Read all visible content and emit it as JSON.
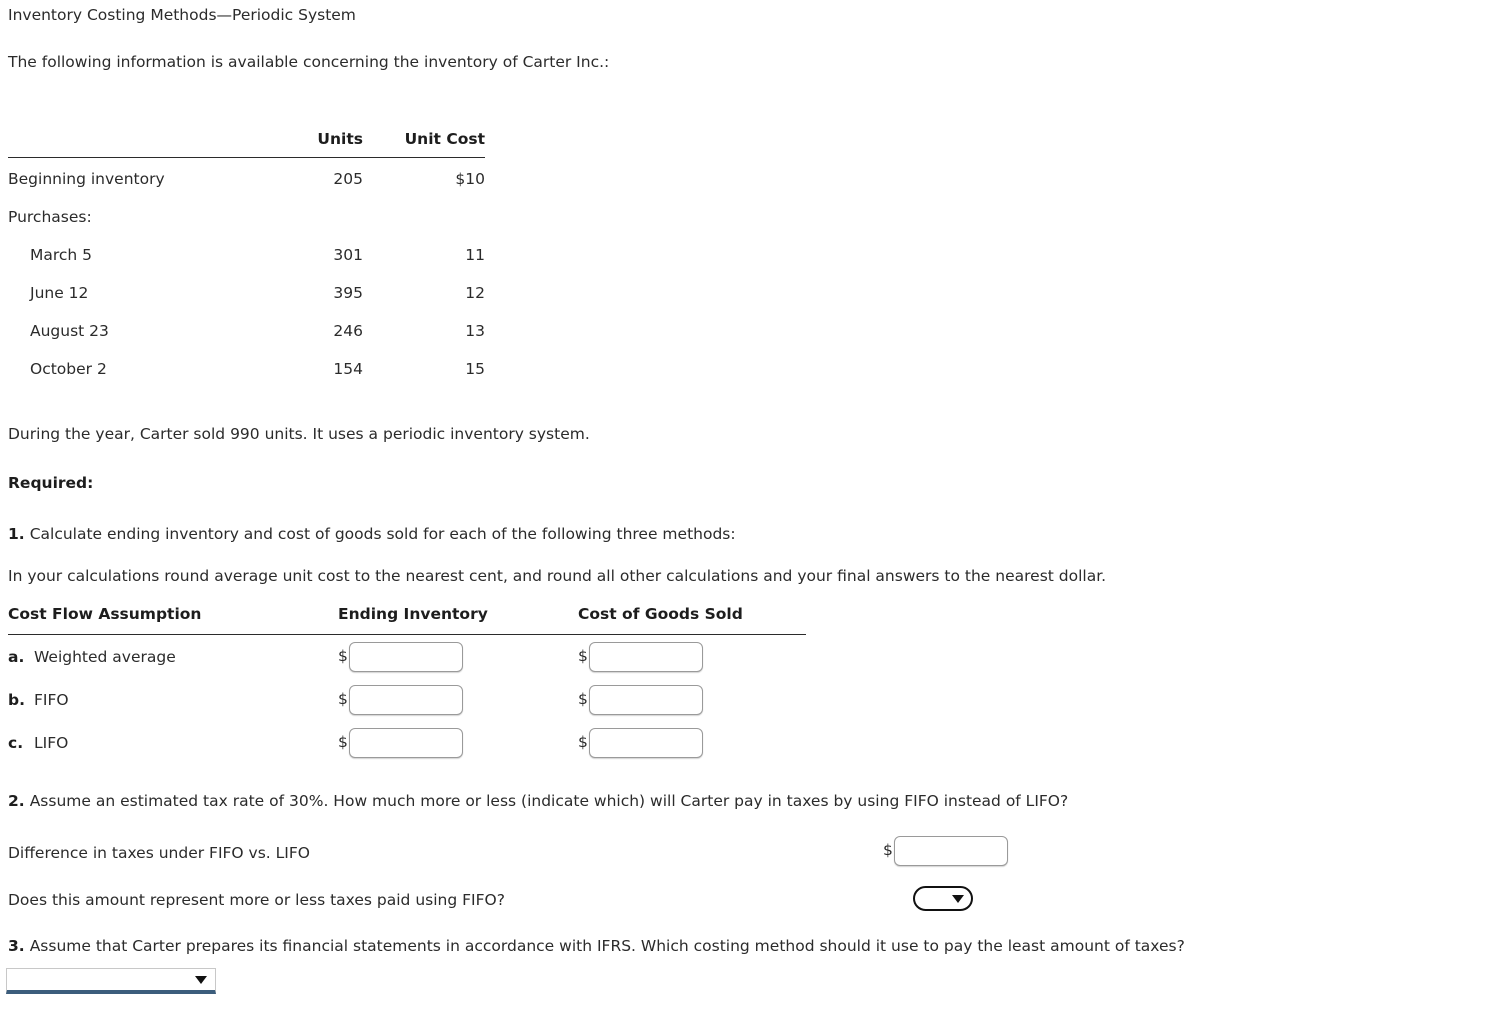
{
  "page": {
    "title": "Inventory Costing Methods—Periodic System",
    "intro": "The following information is available concerning the inventory of Carter Inc.:",
    "sold_note": "During the year, Carter sold 990 units. It uses a periodic inventory system.",
    "required_label": "Required:"
  },
  "inventory_table": {
    "headers": {
      "name": "",
      "units": "Units",
      "unit_cost": "Unit Cost"
    },
    "rows": [
      {
        "name": "Beginning inventory",
        "units": "205",
        "unit_cost": "$10",
        "indent": false
      },
      {
        "name": "Purchases:",
        "units": "",
        "unit_cost": "",
        "indent": false
      },
      {
        "name": "March 5",
        "units": "301",
        "unit_cost": "11",
        "indent": true
      },
      {
        "name": "June 12",
        "units": "395",
        "unit_cost": "12",
        "indent": true
      },
      {
        "name": "August 23",
        "units": "246",
        "unit_cost": "13",
        "indent": true
      },
      {
        "name": "October 2",
        "units": "154",
        "unit_cost": "15",
        "indent": true
      }
    ]
  },
  "question1": {
    "number": "1.",
    "text": "Calculate ending inventory and cost of goods sold for each of the following three methods:",
    "rounding_note": "In your calculations round average unit cost to the nearest cent, and round all other calculations and your final answers to the nearest dollar."
  },
  "answer_table": {
    "headers": {
      "assumption": "Cost Flow Assumption",
      "ending_inventory": "Ending Inventory",
      "cogs": "Cost of Goods Sold"
    },
    "currency_symbol": "$",
    "rows": [
      {
        "letter": "a.",
        "method": "Weighted average",
        "ending_inventory_value": "",
        "cogs_value": ""
      },
      {
        "letter": "b.",
        "method": "FIFO",
        "ending_inventory_value": "",
        "cogs_value": ""
      },
      {
        "letter": "c.",
        "method": "LIFO",
        "ending_inventory_value": "",
        "cogs_value": ""
      }
    ]
  },
  "question2": {
    "number": "2.",
    "text": "Assume an estimated tax rate of 30%. How much more or less (indicate which) will Carter pay in taxes by using FIFO instead of LIFO?",
    "difference_label": "Difference in taxes under FIFO vs. LIFO",
    "difference_currency": "$",
    "difference_value": "",
    "more_or_less_label": "Does this amount represent more or less taxes paid using FIFO?",
    "more_or_less_value": ""
  },
  "question3": {
    "number": "3.",
    "text": "Assume that Carter prepares its financial statements in accordance with IFRS. Which costing method should it use to pay the least amount of taxes?",
    "method_value": ""
  },
  "colors": {
    "text": "#2b2b2b",
    "heading": "#1d1d1d",
    "rule": "#2b2b2b",
    "select_underline": "#3c5d7c",
    "input_border": "#9a9a9a"
  }
}
